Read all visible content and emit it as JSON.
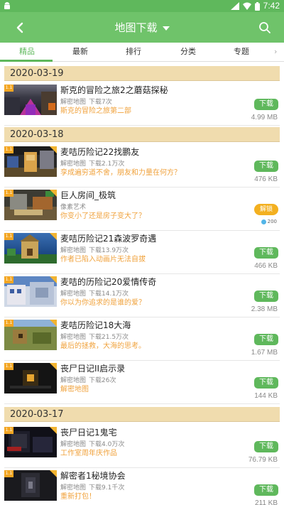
{
  "status_bar": {
    "time": "7:42"
  },
  "app_bar": {
    "title": "地图下载"
  },
  "tabs": [
    {
      "label": "精品",
      "active": true
    },
    {
      "label": "最新"
    },
    {
      "label": "排行"
    },
    {
      "label": "分类"
    },
    {
      "label": "专题"
    }
  ],
  "colors": {
    "accent": "#5fb85c",
    "app_bar": "#6fc36a",
    "desc_text": "#f0a23c",
    "date_header": "#f0dcae",
    "unlock": "#f3b020"
  },
  "sections": [
    {
      "date": "2020-03-19",
      "items": [
        {
          "name": "斯克的冒险之旅2之蘑菇探秘",
          "category": "解密地图",
          "downloads": "下载7次",
          "description": "斯克的冒险之旅第二部",
          "button": "下载",
          "size": "4.99 MB",
          "badge": "1.1"
        }
      ]
    },
    {
      "date": "2020-03-18",
      "items": [
        {
          "name": "麦咭历险记22找鹏友",
          "category": "解密地图",
          "downloads": "下载2.1万次",
          "description": "孪成遍穷道不舍，朋友和力量在何方？",
          "button": "下载",
          "size": "476 KB",
          "badge": "1.1"
        },
        {
          "name": "巨人房间_极筑",
          "category": "像素艺术",
          "downloads": "",
          "description": "你变小了还是房子变大了？",
          "button": "解锁",
          "coins": "200",
          "badge": "1.1"
        },
        {
          "name": "麦咭历险记21森波罗奇遇",
          "category": "解密地图",
          "downloads": "下载13.9万次",
          "description": "作者已陷入动画片无法自拔",
          "button": "下载",
          "size": "466 KB",
          "badge": "1.1"
        },
        {
          "name": "麦咭的历险记20爱情传奇",
          "category": "解密地图",
          "downloads": "下载14.1万次",
          "description": "你以为你追求的是谁的爱？",
          "button": "下载",
          "size": "2.38 MB",
          "badge": "1.1"
        },
        {
          "name": "麦咭历险记18大海",
          "category": "解密地图",
          "downloads": "下载21.5万次",
          "description": "最后的拯救，大海的思考。",
          "button": "下载",
          "size": "1.67 MB",
          "badge": "1.1"
        },
        {
          "name": "丧尸日记II启示录",
          "category": "解密地图",
          "downloads": "下载26次",
          "description": "解密地图",
          "button": "下载",
          "size": "144 KB",
          "badge": "1.1"
        }
      ]
    },
    {
      "date": "2020-03-17",
      "items": [
        {
          "name": "丧尸日记1鬼宅",
          "category": "解密地图",
          "downloads": "下载4.0万次",
          "description": "工作室周年庆作品",
          "button": "下载",
          "size": "76.79 KB",
          "badge": "1.1"
        },
        {
          "name": "解密者1秘境协会",
          "category": "解密地图",
          "downloads": "下载9.1千次",
          "description": "重新打包！",
          "button": "下载",
          "size": "211 KB",
          "badge": "1.1"
        }
      ]
    }
  ]
}
